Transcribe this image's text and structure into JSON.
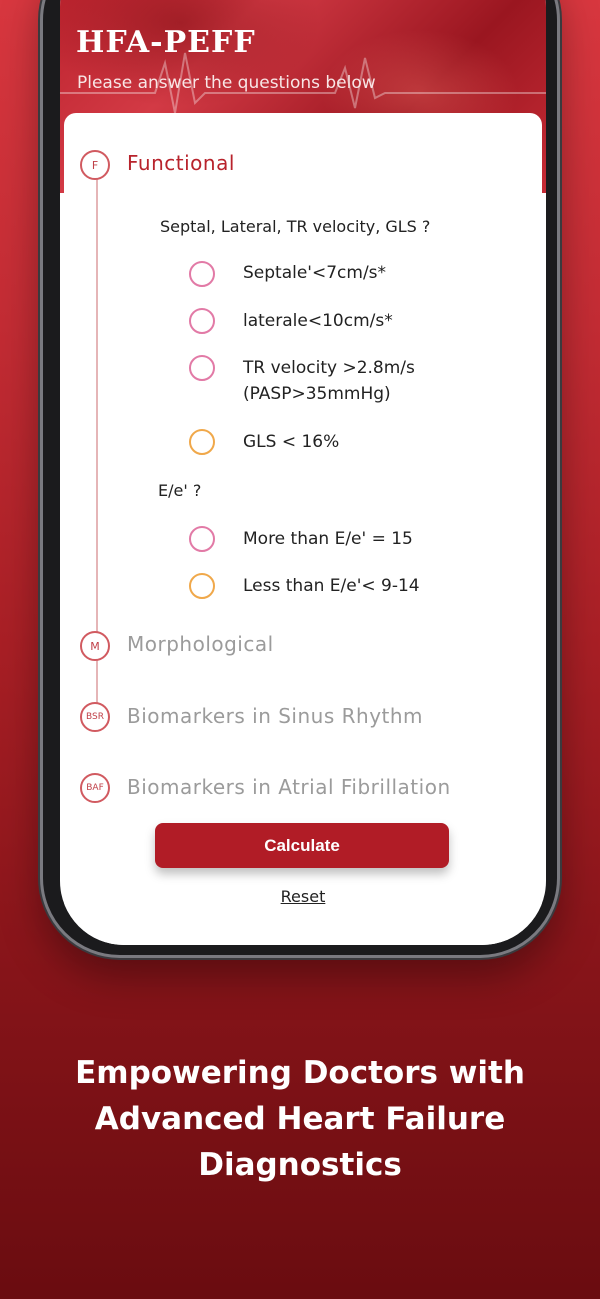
{
  "app": {
    "title": "HFA-PEFF",
    "subtitle": "Please answer the questions below"
  },
  "steps": [
    {
      "abbr": "F",
      "label": "Functional",
      "state": "active"
    },
    {
      "abbr": "M",
      "label": "Morphological",
      "state": "inactive"
    },
    {
      "abbr": "BSR",
      "label": "Biomarkers in Sinus Rhythm",
      "state": "inactive"
    },
    {
      "abbr": "BAF",
      "label": "Biomarkers in Atrial Fibrillation",
      "state": "inactive"
    }
  ],
  "functional": {
    "question1": "Septal, Lateral, TR velocity, GLS ?",
    "options1": [
      {
        "line1": "Septale'<7cm/s*",
        "line2": "",
        "color": "#e27aa6"
      },
      {
        "line1": "laterale<10cm/s*",
        "line2": "",
        "color": "#e27aa6"
      },
      {
        "line1": "TR velocity >2.8m/s",
        "line2": "(PASP>35mmHg)",
        "color": "#e27aa6"
      },
      {
        "line1": "GLS < 16%",
        "line2": "",
        "color": "#f0a84a"
      }
    ],
    "question2": "E/e' ?",
    "options2": [
      {
        "line1": "More than E/e' = 15",
        "color": "#e27aa6"
      },
      {
        "line1": "Less than E/e'< 9-14",
        "color": "#f0a84a"
      }
    ]
  },
  "actions": {
    "calculate_label": "Calculate",
    "reset_label": "Reset"
  },
  "tagline": {
    "line1": "Empowering Doctors with",
    "line2": "Advanced Heart Failure",
    "line3": "Diagnostics"
  },
  "colors": {
    "brand": "#b11c26",
    "radio_pink": "#e27aa6",
    "radio_orange": "#f0a84a"
  }
}
